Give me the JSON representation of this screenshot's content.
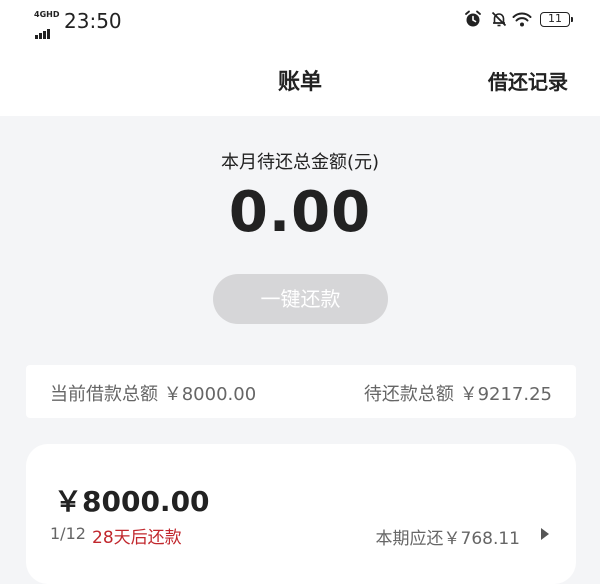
{
  "status_bar": {
    "network": "4GHD",
    "time": "23:50",
    "battery": "11",
    "icons": [
      "alarm-icon",
      "bell-muted-icon",
      "wifi-icon",
      "battery-icon"
    ]
  },
  "header": {
    "title": "账单",
    "action_label": "借还记录"
  },
  "summary": {
    "label": "本月待还总金额(元)",
    "amount": "0.00",
    "repay_button": "一键还款"
  },
  "totals": {
    "current_loan": "当前借款总额 ￥8000.00",
    "pending_repay": "待还款总额 ￥9217.25"
  },
  "loan": {
    "amount": "￥8000.00",
    "period": "1/12",
    "due_text": "28天后还款",
    "installment": "本期应还￥768.11"
  },
  "colors": {
    "background": "#f4f5f7",
    "due_red": "#c1272d",
    "button_disabled": "#d6d6d8"
  }
}
